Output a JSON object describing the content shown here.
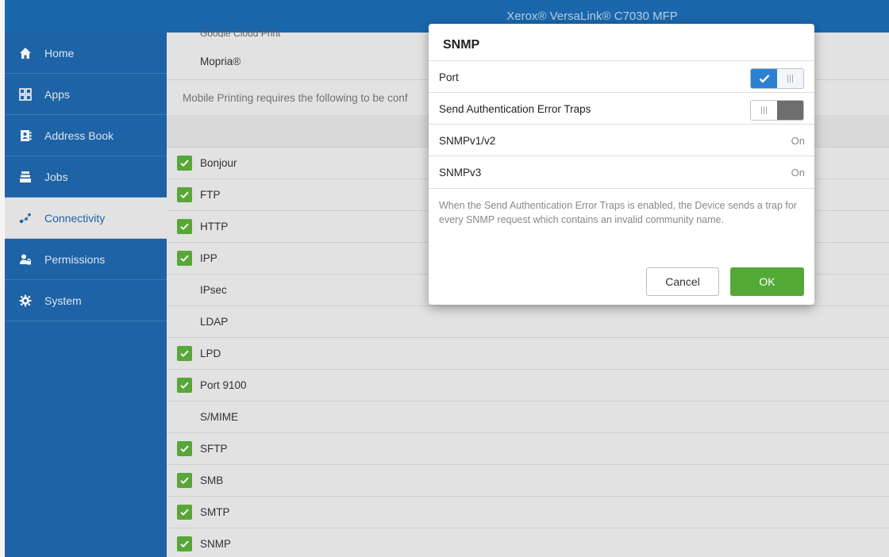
{
  "app": {
    "title": "Xerox® VersaLink® C7030 MFP"
  },
  "sidebar": {
    "items": [
      {
        "label": "Home",
        "icon": "home-icon",
        "active": false
      },
      {
        "label": "Apps",
        "icon": "apps-grid-icon",
        "active": false
      },
      {
        "label": "Address Book",
        "icon": "address-book-icon",
        "active": false
      },
      {
        "label": "Jobs",
        "icon": "jobs-icon",
        "active": false
      },
      {
        "label": "Connectivity",
        "icon": "connectivity-icon",
        "active": true
      },
      {
        "label": "Permissions",
        "icon": "permissions-icon",
        "active": false
      },
      {
        "label": "System",
        "icon": "gear-icon",
        "active": false
      }
    ]
  },
  "content": {
    "partial_row": "Google Cloud Print",
    "mopria": "Mopria®",
    "note": "Mobile Printing requires the following to be conf",
    "protocols": [
      {
        "label": "Bonjour",
        "checked": true
      },
      {
        "label": "FTP",
        "checked": true
      },
      {
        "label": "HTTP",
        "checked": true
      },
      {
        "label": "IPP",
        "checked": true
      },
      {
        "label": "IPsec",
        "checked": false
      },
      {
        "label": "LDAP",
        "checked": false
      },
      {
        "label": "LPD",
        "checked": true
      },
      {
        "label": "Port 9100",
        "checked": true
      },
      {
        "label": "S/MIME",
        "checked": false
      },
      {
        "label": "SFTP",
        "checked": true
      },
      {
        "label": "SMB",
        "checked": true
      },
      {
        "label": "SMTP",
        "checked": true
      },
      {
        "label": "SNMP",
        "checked": true
      }
    ]
  },
  "dialog": {
    "title": "SNMP",
    "rows": [
      {
        "label": "Port",
        "type": "toggle",
        "on": true
      },
      {
        "label": "Send Authentication Error Traps",
        "type": "toggle",
        "on": false
      },
      {
        "label": "SNMPv1/v2",
        "type": "value",
        "value": "On"
      },
      {
        "label": "SNMPv3",
        "type": "value",
        "value": "On"
      }
    ],
    "description": "When the Send Authentication Error Traps is enabled, the Device sends a trap for every SNMP request which contains an invalid community name.",
    "cancel_label": "Cancel",
    "ok_label": "OK"
  },
  "colors": {
    "brand_blue": "#1f68ad",
    "check_green": "#5cad3a",
    "ok_green": "#52a935",
    "toggle_blue": "#2d7fd2"
  }
}
